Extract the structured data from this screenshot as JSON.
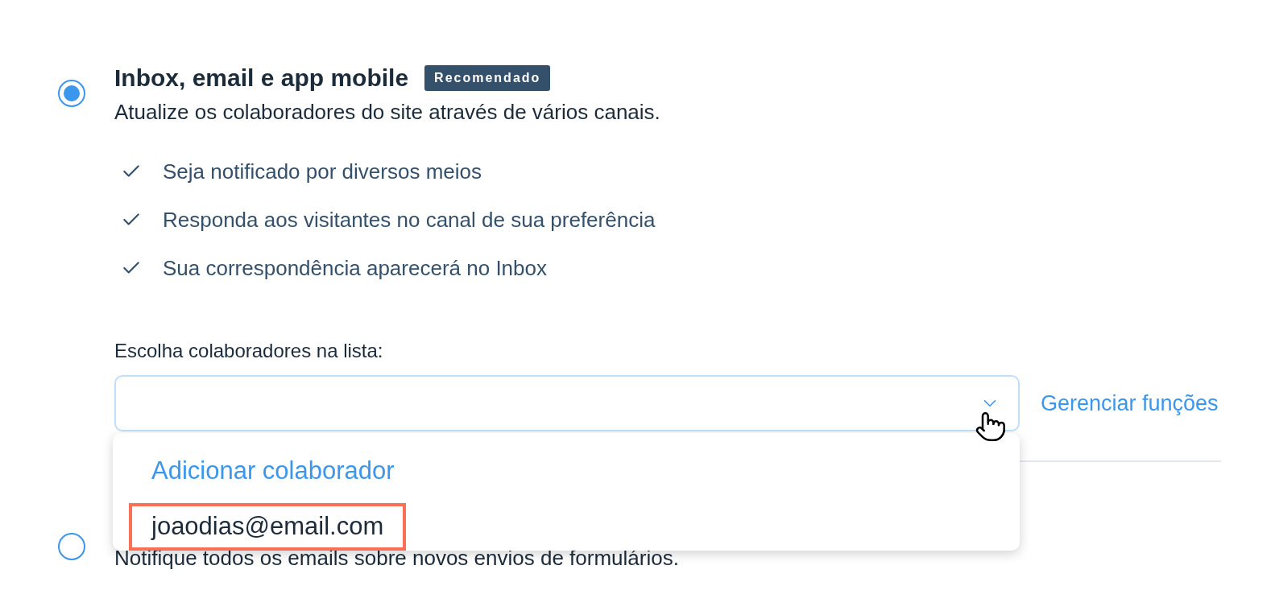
{
  "options": [
    {
      "selected": true,
      "title": "Inbox, email e app mobile",
      "badge": "Recomendado",
      "description": "Atualize os colaboradores do site através de vários canais.",
      "features": [
        "Seja notificado por diversos meios",
        "Responda aos visitantes no canal de sua preferência",
        "Sua correspondência aparecerá no Inbox"
      ],
      "picker": {
        "label": "Escolha colaboradores na lista:",
        "link": "Gerenciar funções",
        "expanded": true,
        "menu": [
          {
            "label": "Adicionar colaborador",
            "kind": "action",
            "highlighted": false
          },
          {
            "label": "joaodias@email.com",
            "kind": "item",
            "highlighted": true
          }
        ]
      }
    },
    {
      "selected": false,
      "description": "Notifique todos os emails sobre novos envios de formulários."
    }
  ]
}
